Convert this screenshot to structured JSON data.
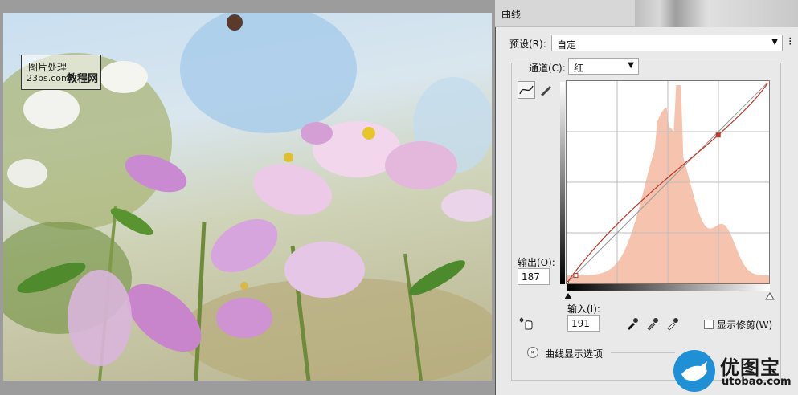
{
  "watermark": {
    "line1": "图片处理",
    "line2": "23ps.com",
    "line3": "教程网"
  },
  "dialog": {
    "title": "曲线",
    "preset_label": "预设(R):",
    "preset_value": "自定",
    "channel_label": "通道(C):",
    "channel_value": "红",
    "output_label": "输出(O):",
    "output_value": "187",
    "input_label": "输入(I):",
    "input_value": "191",
    "show_clipping_label": "显示修剪(W)",
    "curve_options_label": "曲线显示选项"
  },
  "curve": {
    "channel_color": "#c0392b",
    "histogram_color": "#f5b8a0",
    "points": [
      [
        0,
        0
      ],
      [
        191,
        187
      ],
      [
        255,
        255
      ]
    ],
    "black_point_marker": [
      3,
      10
    ]
  },
  "logo": {
    "cn": "优图宝",
    "en": "utobao.com"
  },
  "icons": [
    "curve-point-icon",
    "pencil-icon",
    "hand-adjust-icon",
    "black-eyedropper-icon",
    "gray-eyedropper-icon",
    "white-eyedropper-icon",
    "expand-chevron-icon",
    "bird-icon"
  ]
}
